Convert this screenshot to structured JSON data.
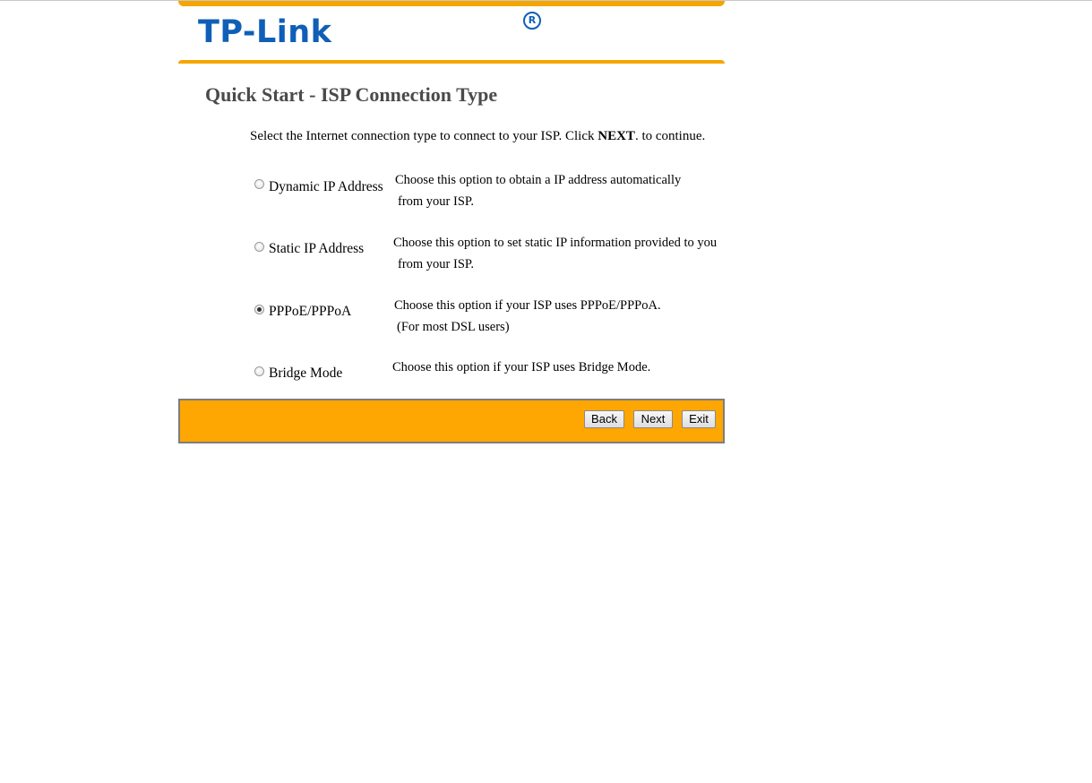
{
  "header": {
    "logo_text": "TP-Link",
    "logo_mark": "R",
    "accent_color": "#f5a500",
    "logo_color": "#0f5fb8"
  },
  "page": {
    "title": "Quick Start - ISP Connection Type",
    "instruction_before": "Select the Internet connection type to connect to your ISP. Click ",
    "instruction_bold": "NEXT",
    "instruction_after": ". to continue."
  },
  "options": [
    {
      "label": "Dynamic IP Address",
      "checked": false,
      "desc_line1": "Choose this option to obtain a IP address automatically",
      "desc_line2": "from your ISP."
    },
    {
      "label": "Static IP Address",
      "checked": false,
      "desc_line1": "Choose this option to set static IP information provided to you",
      "desc_line2": "from your ISP."
    },
    {
      "label": "PPPoE/PPPoA",
      "checked": true,
      "desc_line1": "Choose this option if your ISP uses PPPoE/PPPoA.",
      "desc_line2": "(For most DSL users)"
    },
    {
      "label": "Bridge Mode",
      "checked": false,
      "desc_line1": "Choose this option if your ISP uses Bridge Mode.",
      "desc_line2": ""
    }
  ],
  "footer": {
    "back_label": "Back",
    "next_label": "Next",
    "exit_label": "Exit",
    "bar_color": "#fea601"
  }
}
